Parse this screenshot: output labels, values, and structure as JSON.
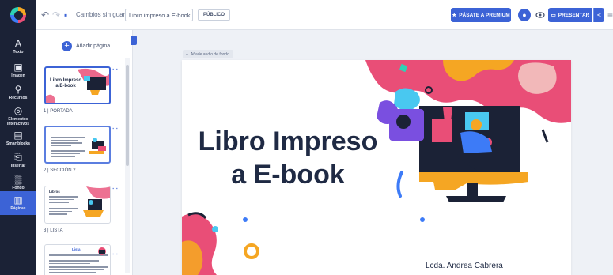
{
  "topbar": {
    "save_status": "Cambios sin guardar",
    "document_title": "Libro impreso a E-book",
    "visibility_badge": "PÚBLICO",
    "premium_label": "PÁSATE A PREMIUM",
    "present_label": "PRESENTAR"
  },
  "rail": {
    "items": [
      {
        "label": "Texto",
        "glyph": "A"
      },
      {
        "label": "Imagen",
        "glyph": "▣"
      },
      {
        "label": "Recursos",
        "glyph": "⚲"
      },
      {
        "label": "Elementos interactivos",
        "glyph": "◎"
      },
      {
        "label": "Smartblocks",
        "glyph": "▤"
      },
      {
        "label": "Insertar",
        "glyph": "⎗"
      },
      {
        "label": "Fondo",
        "glyph": "▒"
      },
      {
        "label": "Páginas",
        "glyph": "▥"
      }
    ]
  },
  "pages_panel": {
    "add_page_label": "Añadir página",
    "pages": [
      {
        "label": "1 | PORTADA",
        "thumb_title": "Libro Impreso a E-book"
      },
      {
        "label": "2 | SECCIÓN 2",
        "thumb_title": ""
      },
      {
        "label": "3 | LISTA",
        "thumb_title": "Libros"
      },
      {
        "label": "",
        "thumb_title": "Lista"
      }
    ]
  },
  "canvas": {
    "audio_chip_label": "Añade audio de fondo",
    "slide_title": "Libro Impreso a E-book",
    "slide_author": "Lcda. Andrea Cabrera"
  },
  "colors": {
    "accent": "#3c63d6",
    "rail_bg": "#1b2236",
    "pink": "#e94e77",
    "orange": "#f5a623",
    "cyan": "#49c8f0"
  }
}
